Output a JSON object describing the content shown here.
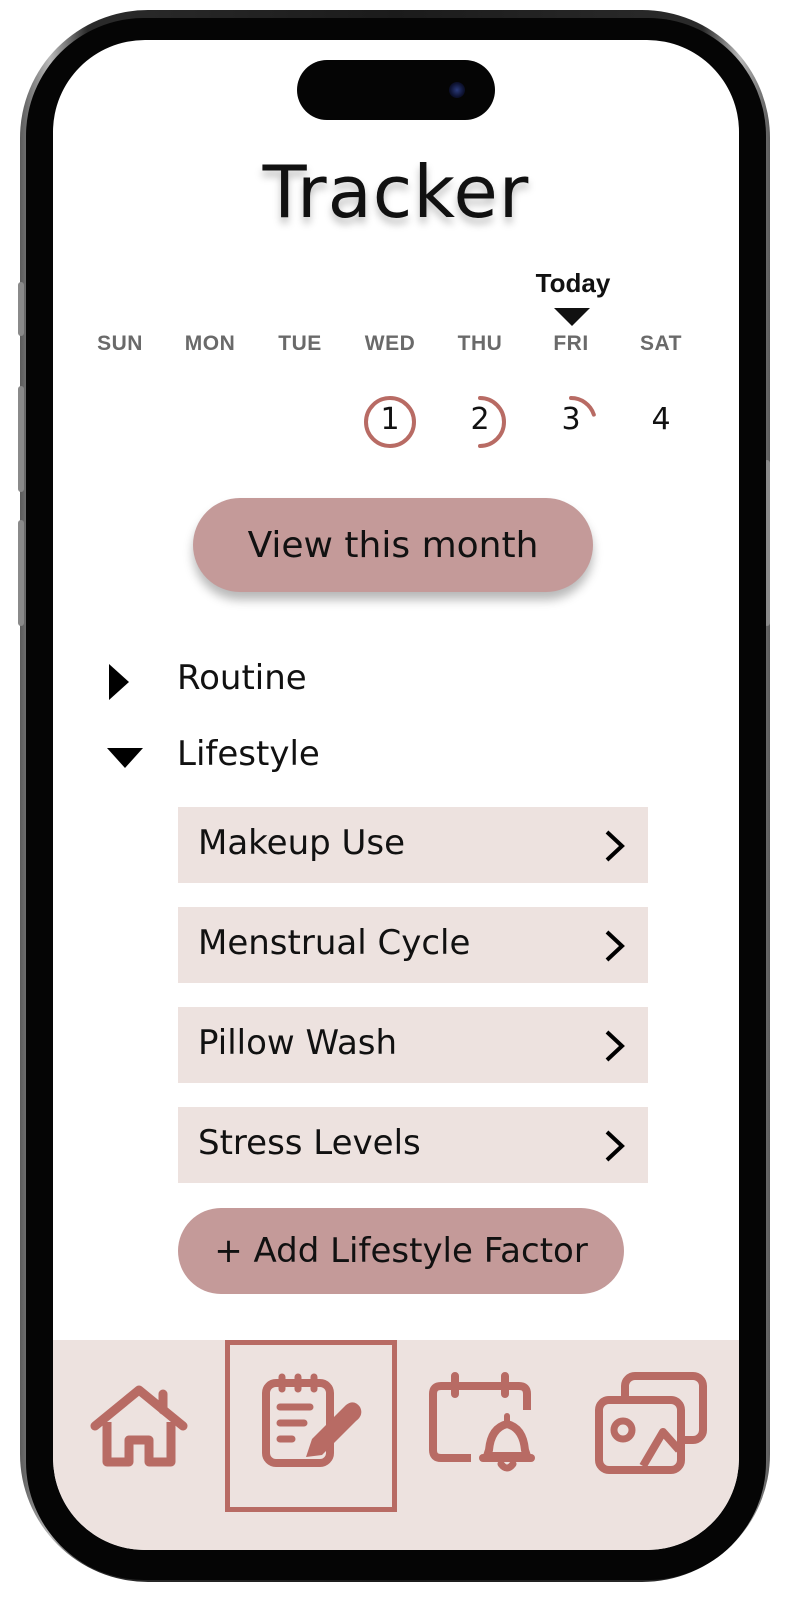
{
  "header": {
    "title": "Tracker"
  },
  "calendar": {
    "today_label": "Today",
    "days": [
      "SUN",
      "MON",
      "TUE",
      "WED",
      "THU",
      "FRI",
      "SAT"
    ],
    "dates": [
      {
        "day": "WED",
        "number": "1",
        "progress": 1.0
      },
      {
        "day": "THU",
        "number": "2",
        "progress": 0.5
      },
      {
        "day": "FRI",
        "number": "3",
        "progress": 0.2
      },
      {
        "day": "SAT",
        "number": "4",
        "progress": 0
      }
    ]
  },
  "view_month_button": "View this month",
  "sections": {
    "routine": {
      "label": "Routine",
      "expanded": false
    },
    "lifestyle": {
      "label": "Lifestyle",
      "expanded": true,
      "items": [
        {
          "label": "Makeup Use"
        },
        {
          "label": "Menstrual Cycle"
        },
        {
          "label": "Pillow Wash"
        },
        {
          "label": "Stress Levels"
        }
      ]
    }
  },
  "add_factor_button": "+ Add Lifestyle Factor",
  "nav": {
    "items": [
      {
        "icon": "home-icon",
        "active": false
      },
      {
        "icon": "journal-edit-icon",
        "active": true
      },
      {
        "icon": "calendar-bell-icon",
        "active": false
      },
      {
        "icon": "photo-gallery-icon",
        "active": false
      }
    ]
  },
  "colors": {
    "accent": "#c49a99",
    "accent_dark": "#b86b64",
    "row_background": "#ede2df",
    "nav_background": "#ede2df"
  }
}
